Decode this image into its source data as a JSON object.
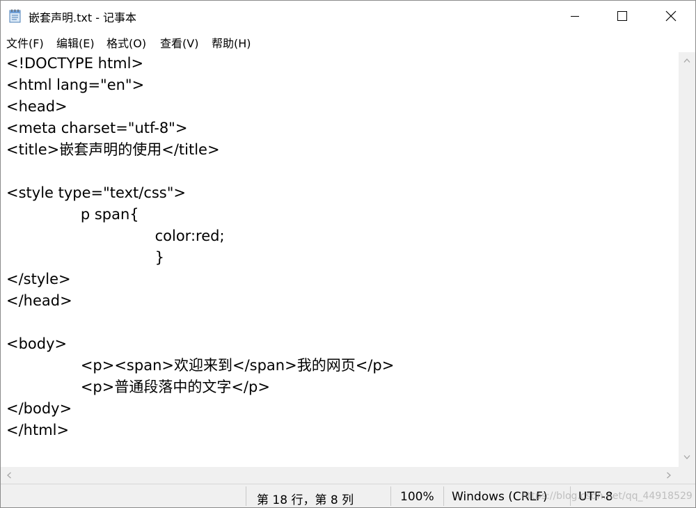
{
  "window": {
    "title": "嵌套声明.txt - 记事本",
    "icon": "notepad-icon",
    "controls": {
      "minimize": "minimize-icon",
      "maximize": "maximize-icon",
      "close": "close-icon"
    }
  },
  "menu": [
    "文件(F)",
    "编辑(E)",
    "格式(O)",
    "查看(V)",
    "帮助(H)"
  ],
  "editor_lines": [
    "<!DOCTYPE html>",
    "<html lang=\"en\">",
    "<head>",
    "<meta charset=\"utf-8\">",
    "<title>嵌套声明的使用</title>",
    "",
    "<style type=\"text/css\">",
    "\t\tp span{",
    "\t\t\t\tcolor:red;",
    "\t\t\t\t}",
    "</style>",
    "</head>",
    "",
    "<body>",
    "\t\t<p><span>欢迎来到</span>我的网页</p>",
    "\t\t<p>普通段落中的文字</p>",
    "</body>",
    "</html>"
  ],
  "status": {
    "position": "第 18 行，第 8 列",
    "zoom": "100%",
    "line_ending": "Windows (CRLF)",
    "encoding": "UTF-8",
    "watermark": "https://blog.csdn.net/qq_44918529"
  }
}
